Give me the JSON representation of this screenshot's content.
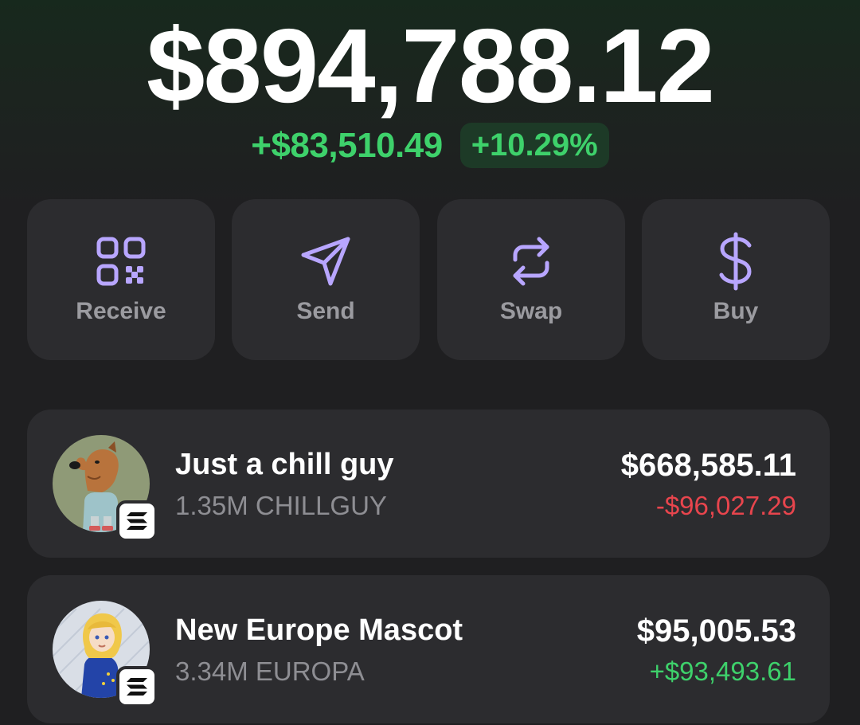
{
  "portfolio": {
    "balance": "$894,788.12",
    "change_amount": "+$83,510.49",
    "change_percent": "+10.29%"
  },
  "actions": [
    {
      "label": "Receive",
      "icon": "qr-code-icon"
    },
    {
      "label": "Send",
      "icon": "paper-plane-icon"
    },
    {
      "label": "Swap",
      "icon": "swap-arrows-icon"
    },
    {
      "label": "Buy",
      "icon": "dollar-sign-icon"
    }
  ],
  "tokens": [
    {
      "name": "Just a chill guy",
      "holding": "1.35M CHILLGUY",
      "value": "$668,585.11",
      "pnl": "-$96,027.29",
      "pnl_direction": "negative",
      "chain": "solana-icon"
    },
    {
      "name": "New Europe Mascot",
      "holding": "3.34M EUROPA",
      "value": "$95,005.53",
      "pnl": "+$93,493.61",
      "pnl_direction": "positive",
      "chain": "solana-icon"
    }
  ],
  "colors": {
    "background": "#1f1f21",
    "card": "#2c2c2f",
    "accent_purple": "#b8a6ff",
    "positive": "#3ed16b",
    "negative": "#e8454d"
  }
}
